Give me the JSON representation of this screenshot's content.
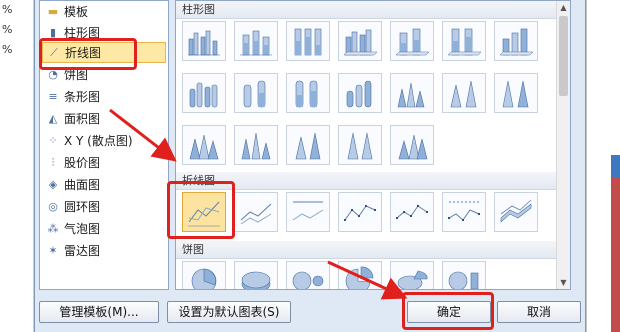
{
  "sheet_left_labels": [
    "%",
    "%",
    "%",
    ""
  ],
  "categories": [
    {
      "label": "模板",
      "icon": "folder-icon",
      "glyph": "▬"
    },
    {
      "label": "柱形图",
      "icon": "column-chart-icon",
      "glyph": "▮"
    },
    {
      "label": "折线图",
      "icon": "line-chart-icon",
      "glyph": "⟋"
    },
    {
      "label": "饼图",
      "icon": "pie-chart-icon",
      "glyph": "◔"
    },
    {
      "label": "条形图",
      "icon": "bar-chart-icon",
      "glyph": "≡"
    },
    {
      "label": "面积图",
      "icon": "area-chart-icon",
      "glyph": "◭"
    },
    {
      "label": "X Y (散点图)",
      "icon": "scatter-chart-icon",
      "glyph": "⁘"
    },
    {
      "label": "股价图",
      "icon": "stock-chart-icon",
      "glyph": "⫶"
    },
    {
      "label": "曲面图",
      "icon": "surface-chart-icon",
      "glyph": "◈"
    },
    {
      "label": "圆环图",
      "icon": "doughnut-chart-icon",
      "glyph": "◎"
    },
    {
      "label": "气泡图",
      "icon": "bubble-chart-icon",
      "glyph": "⁂"
    },
    {
      "label": "雷达图",
      "icon": "radar-chart-icon",
      "glyph": "✶"
    }
  ],
  "selected_category": "折线图",
  "sections": {
    "column": "柱形图",
    "line": "折线图",
    "pie": "饼图"
  },
  "buttons": {
    "manage_templates": "管理模板(M)...",
    "set_default": "设置为默认图表(S)",
    "ok": "确定",
    "cancel": "取消"
  },
  "colors": {
    "selection_fill": "#fde3a0",
    "annotation_red": "#e0201c",
    "dialog_bg": "#dfe9f5"
  }
}
